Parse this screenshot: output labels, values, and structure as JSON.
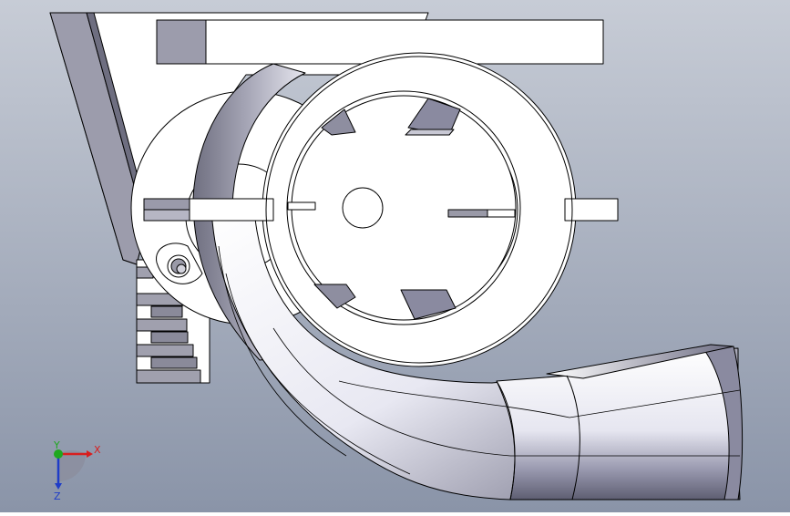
{
  "viewport": {
    "background_top": "#c7ccd6",
    "background_bottom": "#8a94a8"
  },
  "colors": {
    "part_face": "#ffffff",
    "part_edge": "#000000",
    "shade_dark": "#7a7a88",
    "shade_mid": "#a3a3b0",
    "shade_light": "#d8d8e2",
    "axis_x": "#d81e1e",
    "axis_y": "#1fa81f",
    "axis_z": "#1e3cc8"
  },
  "model": {
    "name": "centrifugal-blower-housing",
    "impeller_blades": 6
  },
  "triad": {
    "x_label": "X",
    "y_label": "Y",
    "z_label": "Z"
  }
}
